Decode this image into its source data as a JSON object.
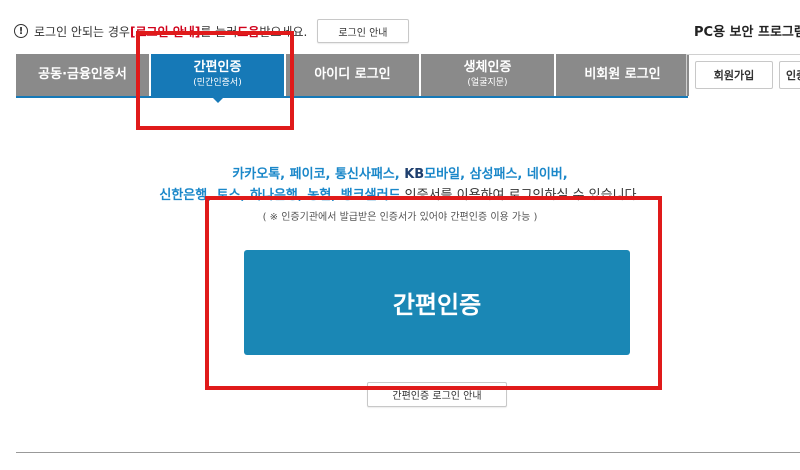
{
  "notice": {
    "icon": "exclamation-circle-icon",
    "prefix": "로그인 안되는 경우",
    "link_text": "[로그인 안내]",
    "middle": "를 눌러 ",
    "help_word": "도움",
    "suffix": "받으세요.",
    "button_label": "로그인 안내"
  },
  "security_program": {
    "label": "PC용 보안 프로그램"
  },
  "tabs": [
    {
      "label": "공동·금융인증서",
      "sub": "",
      "active": false
    },
    {
      "label": "간편인증",
      "sub": "(민간인증서)",
      "active": true
    },
    {
      "label": "아이디 로그인",
      "sub": "",
      "active": false
    },
    {
      "label": "생체인증",
      "sub": "(얼굴지문)",
      "active": false
    },
    {
      "label": "비회원 로그인",
      "sub": "",
      "active": false
    }
  ],
  "member": {
    "signup_label": "회원가입",
    "second_label": "인증"
  },
  "simple_auth": {
    "providers_line1": "카카오톡, 페이코, 통신사패스, ",
    "providers_line1_kb": "KB",
    "providers_line1_rest": "모바일, 삼성패스, 네이버,",
    "providers_line2": "신한은행, 토스, 하나은행, 농협, 뱅크샐러드",
    "providers_line2_suffix": " 인증서를 이용하여 로그인하실 수 있습니다.",
    "note": "( ※ 인증기관에서 발급받은 인증서가 있어야 간편인증 이용 가능 )",
    "main_button_label": "간편인증",
    "guide_button_label": "간편인증 로그인 안내"
  },
  "colors": {
    "tab_active": "#1679b7",
    "tab_inactive": "#8a8a8a",
    "main_button": "#1a87b5",
    "highlight": "#e01a1a",
    "provider_text": "#1a87c9"
  }
}
